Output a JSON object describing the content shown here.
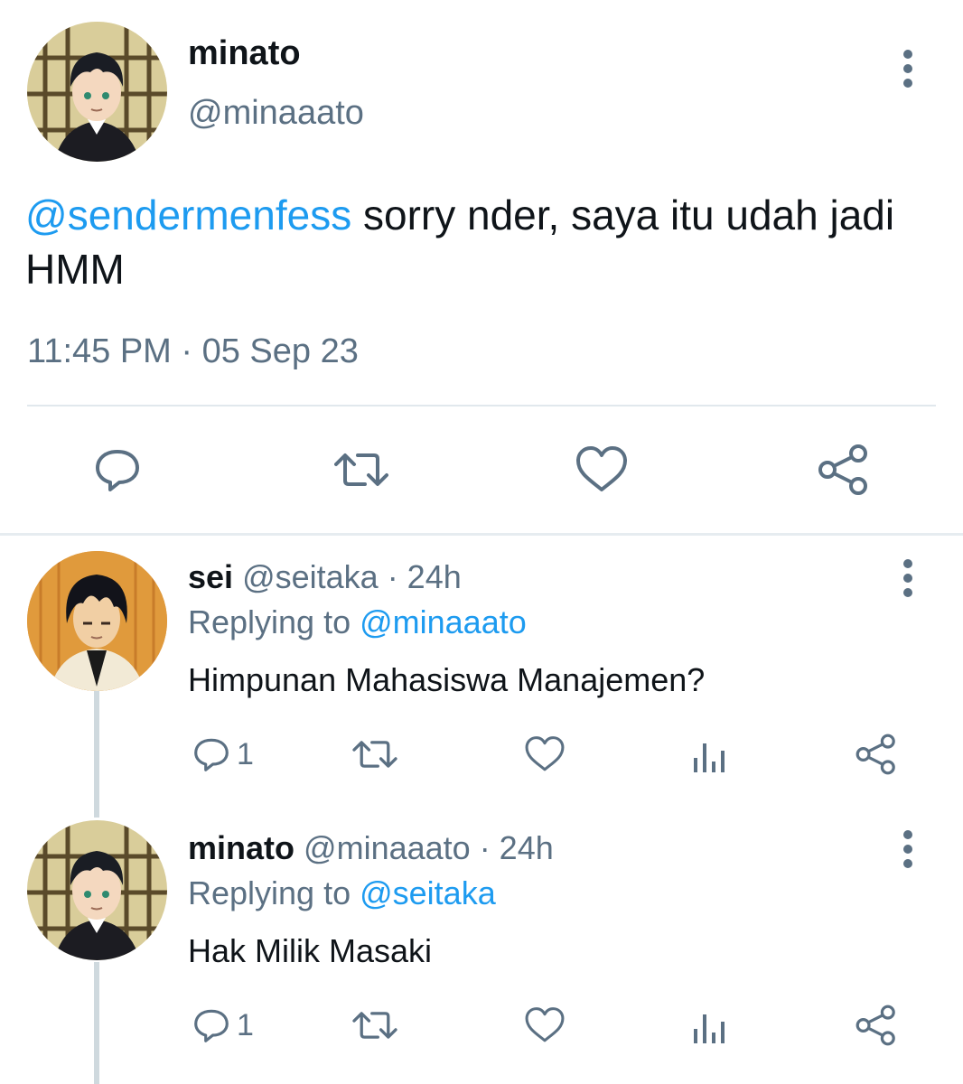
{
  "main": {
    "name": "minato",
    "handle": "@minaaato",
    "mention": "@sendermenfess",
    "text": " sorry nder, saya itu udah jadi HMM",
    "timestamp": "11:45 PM · 05 Sep 23",
    "actions": [
      "reply-icon",
      "retweet-icon",
      "like-icon",
      "share-icon"
    ]
  },
  "replies": [
    {
      "name": "sei",
      "handle": "@seitaka",
      "age": "· 24h",
      "replying_prefix": "Replying to ",
      "replying_to": "@minaaato",
      "text": "Himpunan Mahasiswa Manajemen?",
      "reply_count": "1"
    },
    {
      "name": "minato",
      "handle": "@minaaato",
      "age": "· 24h",
      "replying_prefix": "Replying to ",
      "replying_to": "@seitaka",
      "text": "Hak Milik Masaki",
      "reply_count": "1"
    }
  ],
  "colors": {
    "link": "#1d9bf0",
    "secondary": "#5b7083",
    "text": "#0f1419"
  }
}
